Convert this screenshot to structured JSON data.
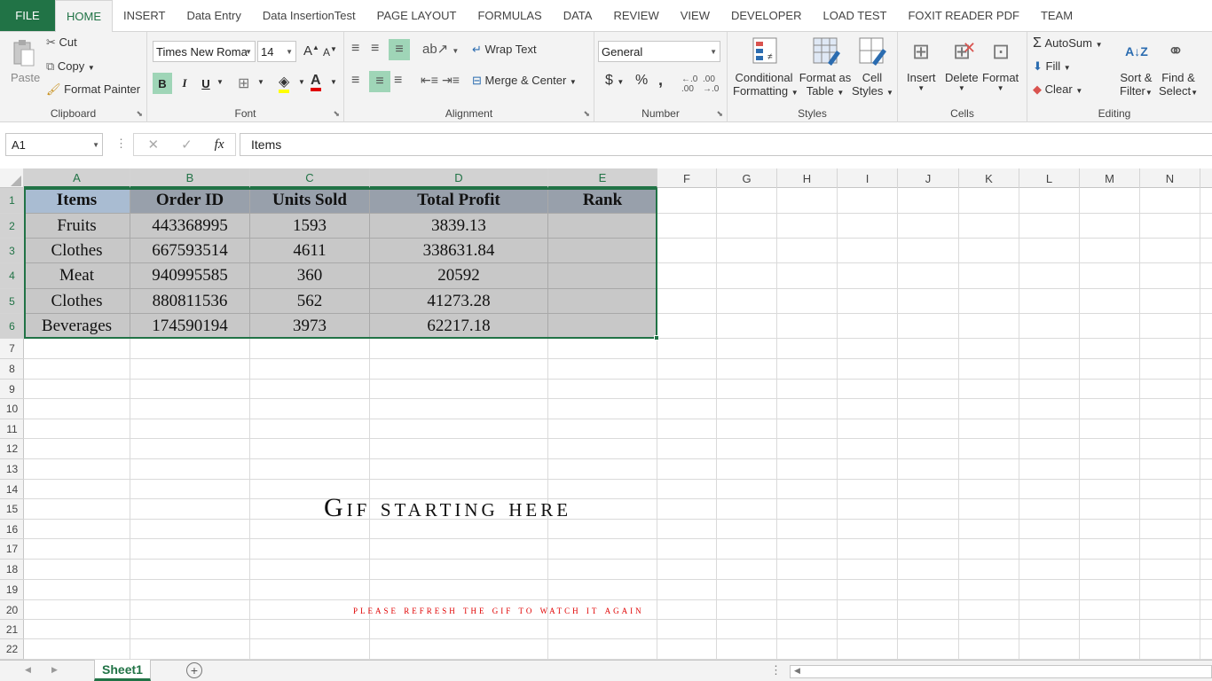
{
  "tabs": [
    "FILE",
    "HOME",
    "INSERT",
    "Data Entry",
    "Data InsertionTest",
    "PAGE LAYOUT",
    "FORMULAS",
    "DATA",
    "REVIEW",
    "VIEW",
    "DEVELOPER",
    "LOAD TEST",
    "FOXIT READER PDF",
    "TEAM"
  ],
  "active_tab": "HOME",
  "clipboard": {
    "paste": "Paste",
    "cut": "Cut",
    "copy": "Copy",
    "format_painter": "Format Painter",
    "label": "Clipboard"
  },
  "font": {
    "name": "Times New Roma",
    "size": "14",
    "bold": "B",
    "italic": "I",
    "underline": "U",
    "label": "Font"
  },
  "alignment": {
    "wrap": "Wrap Text",
    "merge": "Merge & Center",
    "label": "Alignment"
  },
  "number": {
    "format": "General",
    "currency": "$",
    "percent": "%",
    "comma": ",",
    "label": "Number"
  },
  "styles": {
    "conditional_1": "Conditional",
    "conditional_2": "Formatting",
    "format_table_1": "Format as",
    "format_table_2": "Table",
    "cell_styles_1": "Cell",
    "cell_styles_2": "Styles",
    "label": "Styles"
  },
  "cells": {
    "insert": "Insert",
    "delete": "Delete",
    "format": "Format",
    "label": "Cells"
  },
  "editing": {
    "autosum": "AutoSum",
    "fill": "Fill",
    "clear": "Clear",
    "sort_1": "Sort &",
    "sort_2": "Filter",
    "find_1": "Find &",
    "find_2": "Select",
    "label": "Editing"
  },
  "formula_bar": {
    "name_box": "A1",
    "fx": "fx",
    "content": "Items"
  },
  "columns": [
    "A",
    "B",
    "C",
    "D",
    "E",
    "F",
    "G",
    "H",
    "I",
    "J",
    "K",
    "L",
    "M",
    "N"
  ],
  "rows": [
    "1",
    "2",
    "3",
    "4",
    "5",
    "6",
    "7",
    "8",
    "9",
    "10",
    "11",
    "12",
    "13",
    "14",
    "15",
    "16",
    "17",
    "18",
    "19",
    "20",
    "21",
    "22"
  ],
  "table": {
    "headers": [
      "Items",
      "Order ID",
      "Units Sold",
      "Total Profit",
      "Rank"
    ],
    "rows": [
      [
        "Fruits",
        "443368995",
        "1593",
        "3839.13",
        ""
      ],
      [
        "Clothes",
        "667593514",
        "4611",
        "338631.84",
        ""
      ],
      [
        "Meat",
        "940995585",
        "360",
        "20592",
        ""
      ],
      [
        "Clothes",
        "880811536",
        "562",
        "41273.28",
        ""
      ],
      [
        "Beverages",
        "174590194",
        "3973",
        "62217.18",
        ""
      ]
    ]
  },
  "overlay": {
    "title": "Gif starting here",
    "note": "please refresh the gif to watch it again"
  },
  "sheet_tab": "Sheet1",
  "colors": {
    "accent": "#217346",
    "header_fill": "#98a0ab",
    "cell_fill": "#c8c8c8",
    "note": "#e00000"
  }
}
